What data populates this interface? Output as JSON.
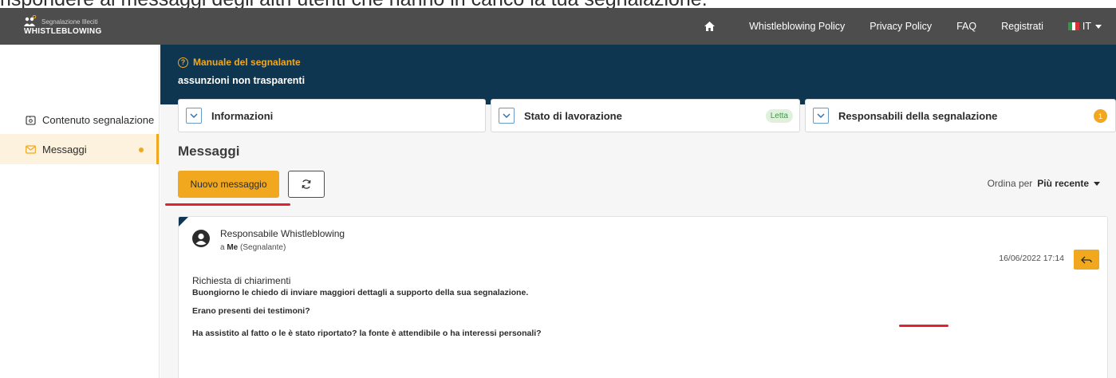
{
  "caption": "rispondere ai messaggi degli altri utenti che hanno in carico la tua segnalazione.",
  "header": {
    "logo_small": "Segnalazione Illeciti",
    "logo_big": "WHISTLEBLOWING",
    "nav": [
      "Whistleblowing Policy",
      "Privacy Policy",
      "FAQ",
      "Registrati"
    ],
    "language": "IT",
    "home_icon": "home-icon"
  },
  "sidebar": {
    "items": [
      {
        "label": "Contenuto segnalazione",
        "icon": "document-icon"
      },
      {
        "label": "Messaggi",
        "icon": "envelope-icon",
        "active": true
      }
    ]
  },
  "banner": {
    "manual": "Manuale del segnalante",
    "report_title": "assunzioni non trasparenti"
  },
  "panels": {
    "info": "Informazioni",
    "status": "Stato di lavorazione",
    "status_badge": "Letta",
    "managers": "Responsabili della segnalazione",
    "managers_count": "1"
  },
  "messages_section": {
    "title": "Messaggi",
    "new_button": "Nuovo messaggio",
    "sort_label": "Ordina per",
    "sort_value": "Più recente"
  },
  "message": {
    "sender": "Responsabile Whistleblowing",
    "to_prefix": "a",
    "to_name": "Me",
    "to_role": "(Segnalante)",
    "timestamp": "16/06/2022 17:14",
    "subject": "Richiesta di chiarimenti",
    "body": [
      "Buongiorno le chiedo di inviare maggiori dettagli a supporto della sua segnalazione.",
      "Erano presenti dei testimoni?",
      "Ha assistito al fatto o le è stato riportato? la fonte è attendibile o ha interessi personali?"
    ]
  },
  "colors": {
    "accent": "#f1a81e",
    "banner": "#0f3650",
    "topbar": "#4d4d4d",
    "highlight": "#e0232c"
  }
}
